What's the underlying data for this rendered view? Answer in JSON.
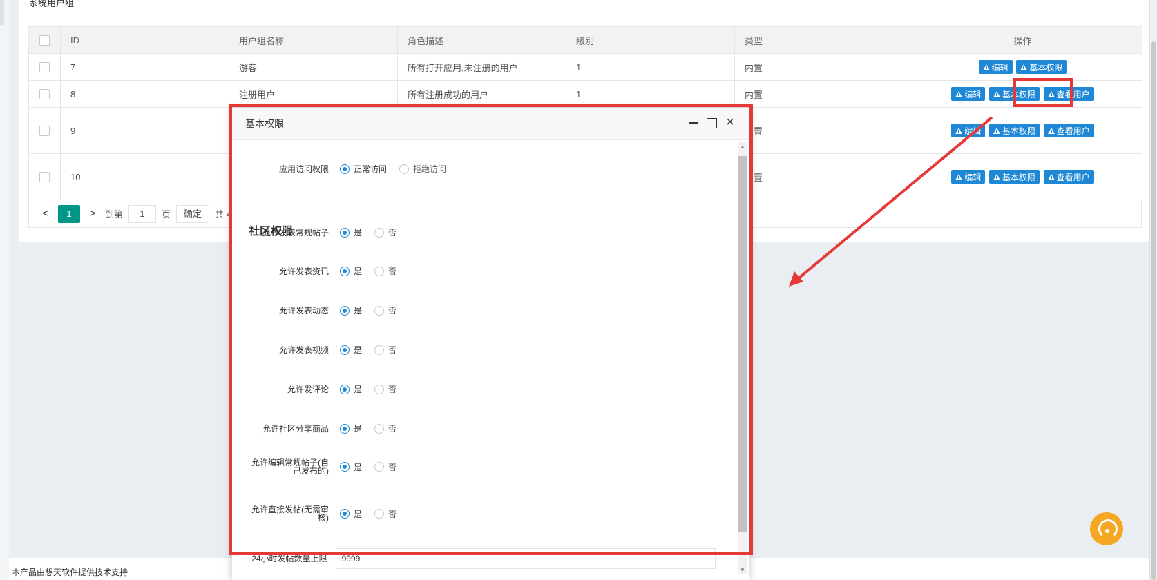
{
  "page": {
    "top_title": "系统用户组",
    "footer": "本产品由想天软件提供技术支持"
  },
  "table": {
    "headers": [
      "",
      "ID",
      "用户组名称",
      "角色描述",
      "级别",
      "类型",
      "操作"
    ],
    "rows": [
      {
        "id": "7",
        "name": "游客",
        "desc": "所有打开应用,未注册的用户",
        "level": "1",
        "type": "内置",
        "ops": [
          "编辑",
          "基本权限"
        ]
      },
      {
        "id": "8",
        "name": "注册用户",
        "desc": "所有注册成功的用户",
        "level": "1",
        "type": "内置",
        "ops": [
          "编辑",
          "基本权限",
          "查看用户"
        ]
      },
      {
        "id": "9",
        "name": "",
        "desc": "",
        "level": "",
        "type": "内置",
        "ops": [
          "编辑",
          "基本权限",
          "查看用户"
        ]
      },
      {
        "id": "10",
        "name": "",
        "desc": "",
        "level": "",
        "type": "内置",
        "ops": [
          "编辑",
          "基本权限",
          "查看用户"
        ]
      }
    ]
  },
  "pager": {
    "prev": "<",
    "current": "1",
    "next": ">",
    "goto_label": "到第",
    "page_input": "1",
    "page_unit": "页",
    "confirm": "确定",
    "total": "共 4"
  },
  "dialog": {
    "title": "基本权限",
    "access_label": "应用访问权限",
    "access_options": [
      "正常访问",
      "拒绝访问"
    ],
    "access_selected": "正常访问",
    "section_title": "社区权限",
    "yes": "是",
    "no": "否",
    "permissions": [
      {
        "label_line1": "允许发表常规帖子",
        "label_line2": "",
        "value": "是"
      },
      {
        "label_line1": "允许发表资讯",
        "label_line2": "",
        "value": "是"
      },
      {
        "label_line1": "允许发表动态",
        "label_line2": "",
        "value": "是"
      },
      {
        "label_line1": "允许发表视频",
        "label_line2": "",
        "value": "是"
      },
      {
        "label_line1": "允许发评论",
        "label_line2": "",
        "value": "是"
      },
      {
        "label_line1": "允许社区分享商品",
        "label_line2": "",
        "value": "是"
      },
      {
        "label_line1": "允许编辑常规帖子(自",
        "label_line2": "己发布的)",
        "value": "是"
      },
      {
        "label_line1": "允许直接发帖(无需审",
        "label_line2": "核)",
        "value": "是"
      }
    ],
    "limit_label": "24小时发帖数量上限",
    "limit_value": "9999"
  },
  "colors": {
    "primary_button": "#1e88d6",
    "pager_active": "#009688",
    "highlight": "#e53935",
    "support": "#f5a623"
  }
}
